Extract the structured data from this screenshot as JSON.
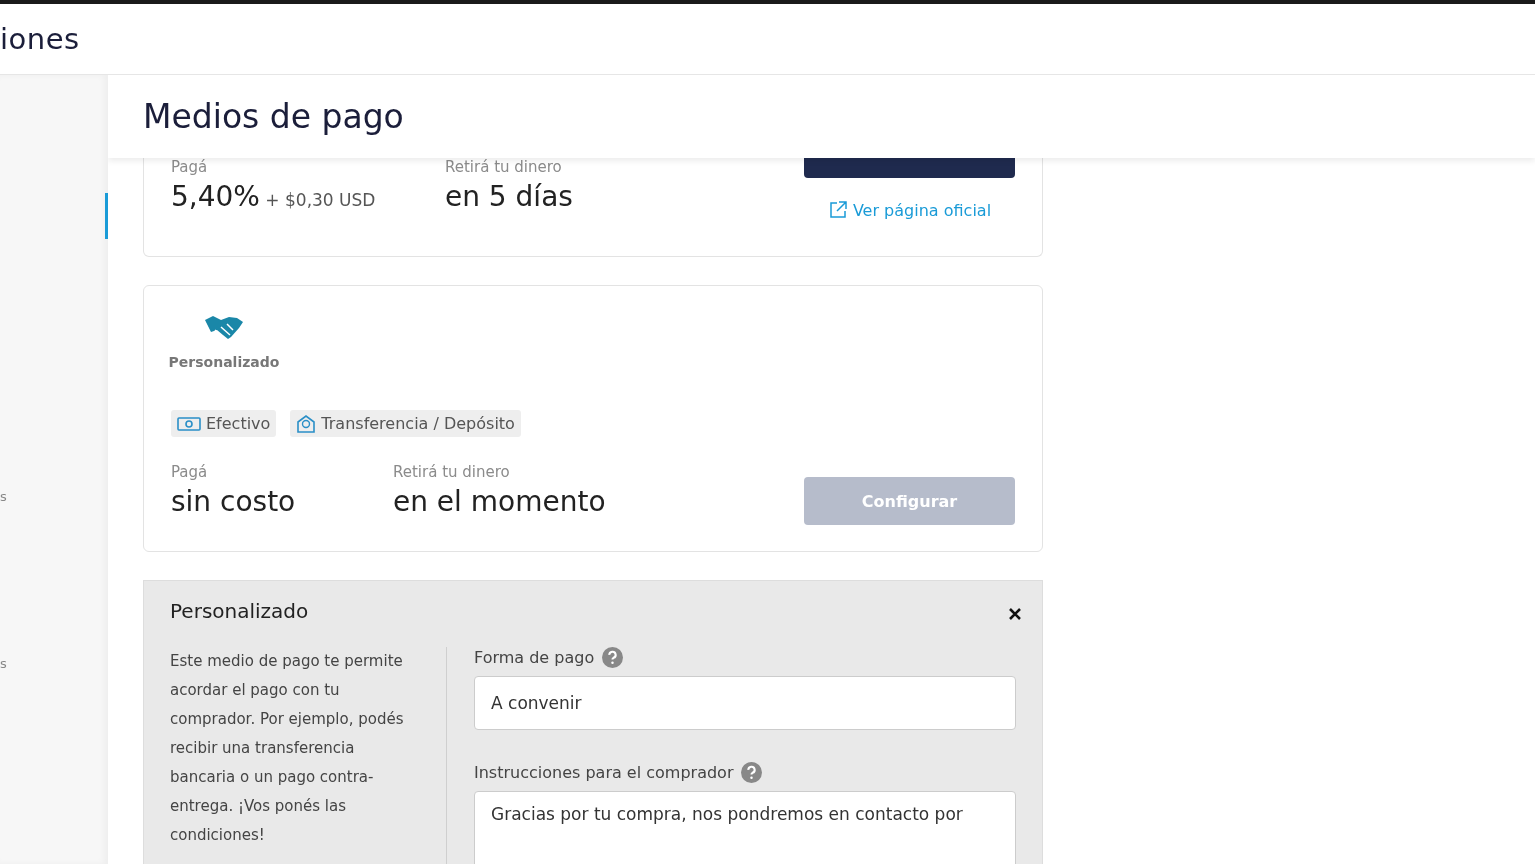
{
  "header": {
    "title": "iones"
  },
  "sidebar": {
    "items": [
      {
        "label": "s"
      },
      {
        "label": "s"
      }
    ]
  },
  "page": {
    "title": "Medios de pago"
  },
  "methods": [
    {
      "kind": "cut",
      "fee_label": "Pagá",
      "fee": "5,40%",
      "fee_extra": "+ $0,30 USD",
      "payout_label": "Retirá tu dinero",
      "payout": "en 5 días",
      "button": {
        "disabled": false
      },
      "link": "Ver página oficial"
    },
    {
      "kind": "full",
      "logo_label": "Personalizado",
      "tags": [
        {
          "kind": "cash",
          "label": "Efectivo"
        },
        {
          "kind": "transfer",
          "label": "Transferencia / Depósito"
        }
      ],
      "fee_label": "Pagá",
      "fee": "sin costo",
      "payout_label": "Retirá tu dinero",
      "payout": "en el momento",
      "button": {
        "label": "Configurar",
        "disabled": true
      }
    }
  ],
  "config_panel": {
    "title": "Personalizado",
    "description": "Este medio de pago te permite acordar el pago con tu comprador. Por ejemplo, podés recibir una transferencia bancaria o un pago contra-entrega. ¡Vos ponés las condiciones!",
    "fields": [
      {
        "kind": "input",
        "label": "Forma de pago",
        "value": "A convenir"
      },
      {
        "kind": "textarea",
        "label": "Instrucciones para el comprador",
        "value": "Gracias por tu compra, nos pondremos en contacto por"
      }
    ]
  }
}
